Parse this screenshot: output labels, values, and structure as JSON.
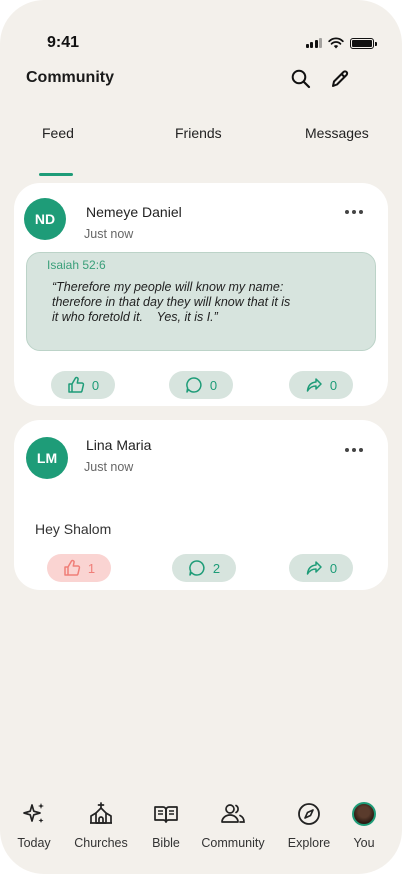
{
  "status_bar": {
    "time": "9:41"
  },
  "header": {
    "title": "Community"
  },
  "tabs": [
    {
      "label": "Feed",
      "active": true
    },
    {
      "label": "Friends",
      "active": false
    },
    {
      "label": "Messages",
      "active": false
    }
  ],
  "posts": [
    {
      "initials": "ND",
      "author": "Nemeye Daniel",
      "time": "Just now",
      "verse_ref": "Isaiah 52:6",
      "verse_text": "“Therefore my people will know my name:\ntherefore in that day they will know that it is\nit who foretold it.    Yes, it is I.”",
      "likes": "0",
      "comments": "0",
      "shares": "0",
      "liked": false
    },
    {
      "initials": "LM",
      "author": "Lina Maria",
      "time": "Just now",
      "text": "Hey Shalom",
      "likes": "1",
      "comments": "2",
      "shares": "0",
      "liked": true
    }
  ],
  "bottom_nav": [
    {
      "label": "Today",
      "icon": "sparkles-icon"
    },
    {
      "label": "Churches",
      "icon": "church-icon"
    },
    {
      "label": "Bible",
      "icon": "book-icon"
    },
    {
      "label": "Community",
      "icon": "people-icon"
    },
    {
      "label": "Explore",
      "icon": "compass-icon"
    },
    {
      "label": "You",
      "icon": "avatar"
    }
  ],
  "colors": {
    "accent": "#1e9c78",
    "background": "#f3f0eb",
    "liked": "#f07e78"
  }
}
